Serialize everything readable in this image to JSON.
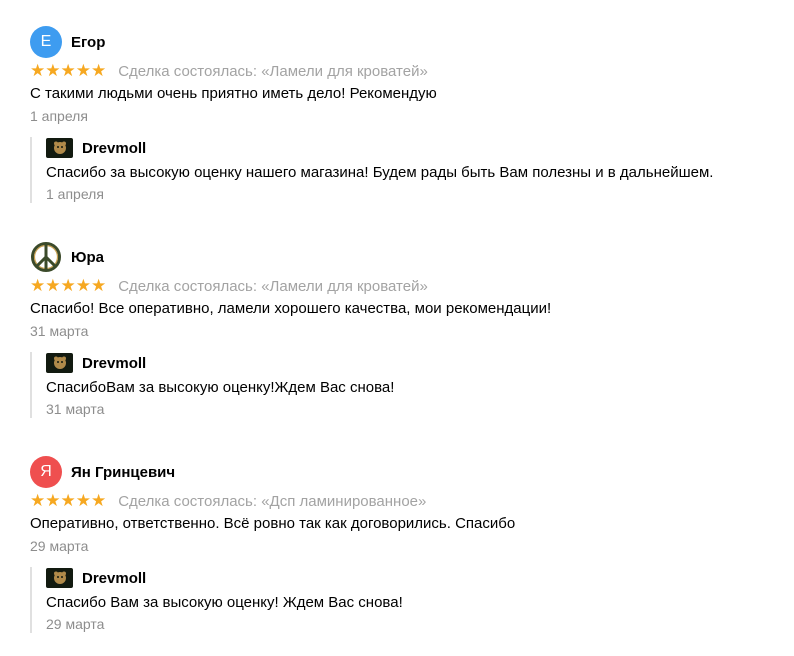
{
  "reviews": [
    {
      "avatar_letter": "Е",
      "avatar_color": "#3e9cf0",
      "name": "Егор",
      "stars": "★★★★★",
      "deal": "Сделка состоялась: «Ламели для кроватей»",
      "text": "С такими людьми очень приятно иметь дело! Рекомендую",
      "date": "1 апреля",
      "reply": {
        "name": "Drevmoll",
        "text": "Спасибо за высокую оценку нашего магазина! Будем рады быть Вам полезны и в дальнейшем.",
        "date": "1 апреля"
      }
    },
    {
      "avatar_icon": "peace-sign-icon",
      "name": "Юра",
      "stars": "★★★★★",
      "deal": "Сделка состоялась: «Ламели для кроватей»",
      "text": "Спасибо! Все оперативно, ламели хорошего качества, мои рекомендации!",
      "date": "31 марта",
      "reply": {
        "name": "Drevmoll",
        "text": "СпасибоВам за высокую оценку!Ждем Вас снова!",
        "date": "31 марта"
      }
    },
    {
      "avatar_letter": "Я",
      "avatar_color": "#ef4f4f",
      "name": "Ян Гринцевич",
      "stars": "★★★★★",
      "deal": "Сделка состоялась: «Дсп ламинированное»",
      "text": "Оперативно, ответственно. Всё ровно так как договорились. Спасибо",
      "date": "29 марта",
      "reply": {
        "name": "Drevmoll",
        "text": "Спасибо Вам за высокую оценку! Ждем Вас снова!",
        "date": "29 марта"
      }
    }
  ],
  "colors": {
    "star": "#f6a821",
    "muted": "#a3a3a3"
  }
}
